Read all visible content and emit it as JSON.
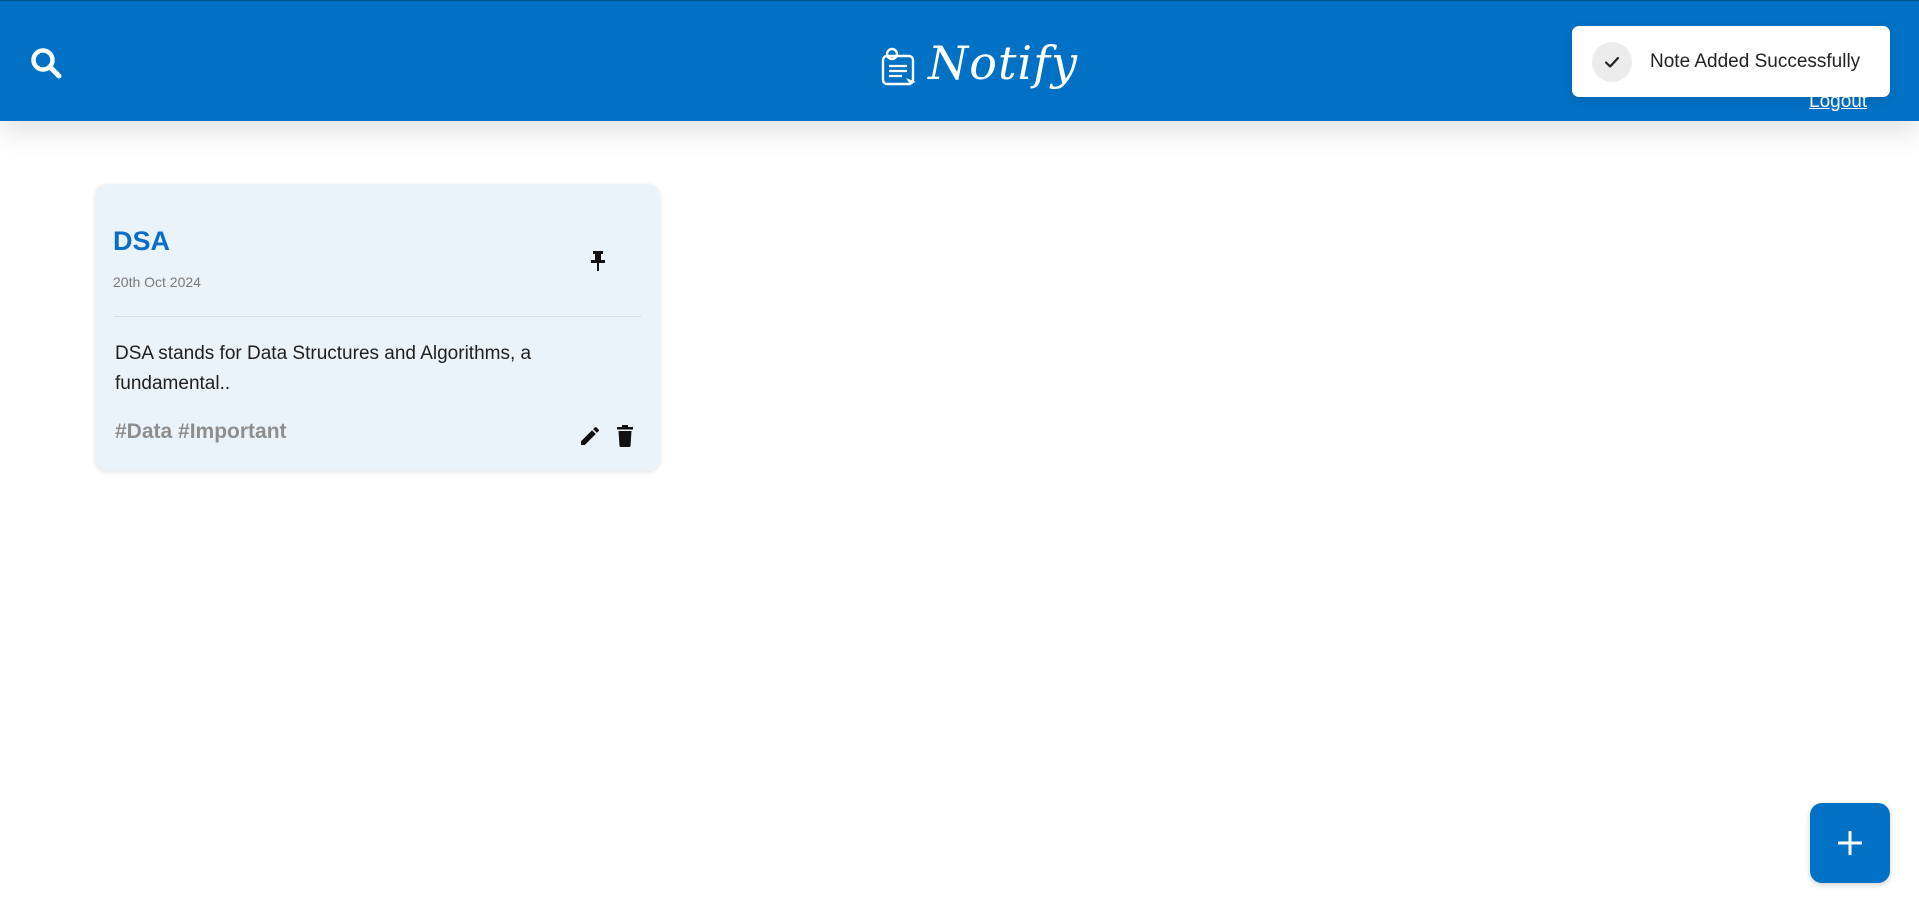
{
  "app": {
    "name": "Notify",
    "brand_color": "#0071c5"
  },
  "header": {
    "search_icon": "search-icon",
    "logout_label": "Logout"
  },
  "toast": {
    "icon": "check-icon",
    "message": "Note Added Successfully"
  },
  "notes": [
    {
      "title": "DSA",
      "date": "20th Oct 2024",
      "content": "DSA stands for Data Structures and Algorithms, a fundamental..",
      "tags": "#Data #Important",
      "pin_icon": "pin-icon",
      "edit_icon": "pencil-icon",
      "delete_icon": "trash-icon"
    }
  ],
  "fab": {
    "icon": "plus-icon"
  }
}
